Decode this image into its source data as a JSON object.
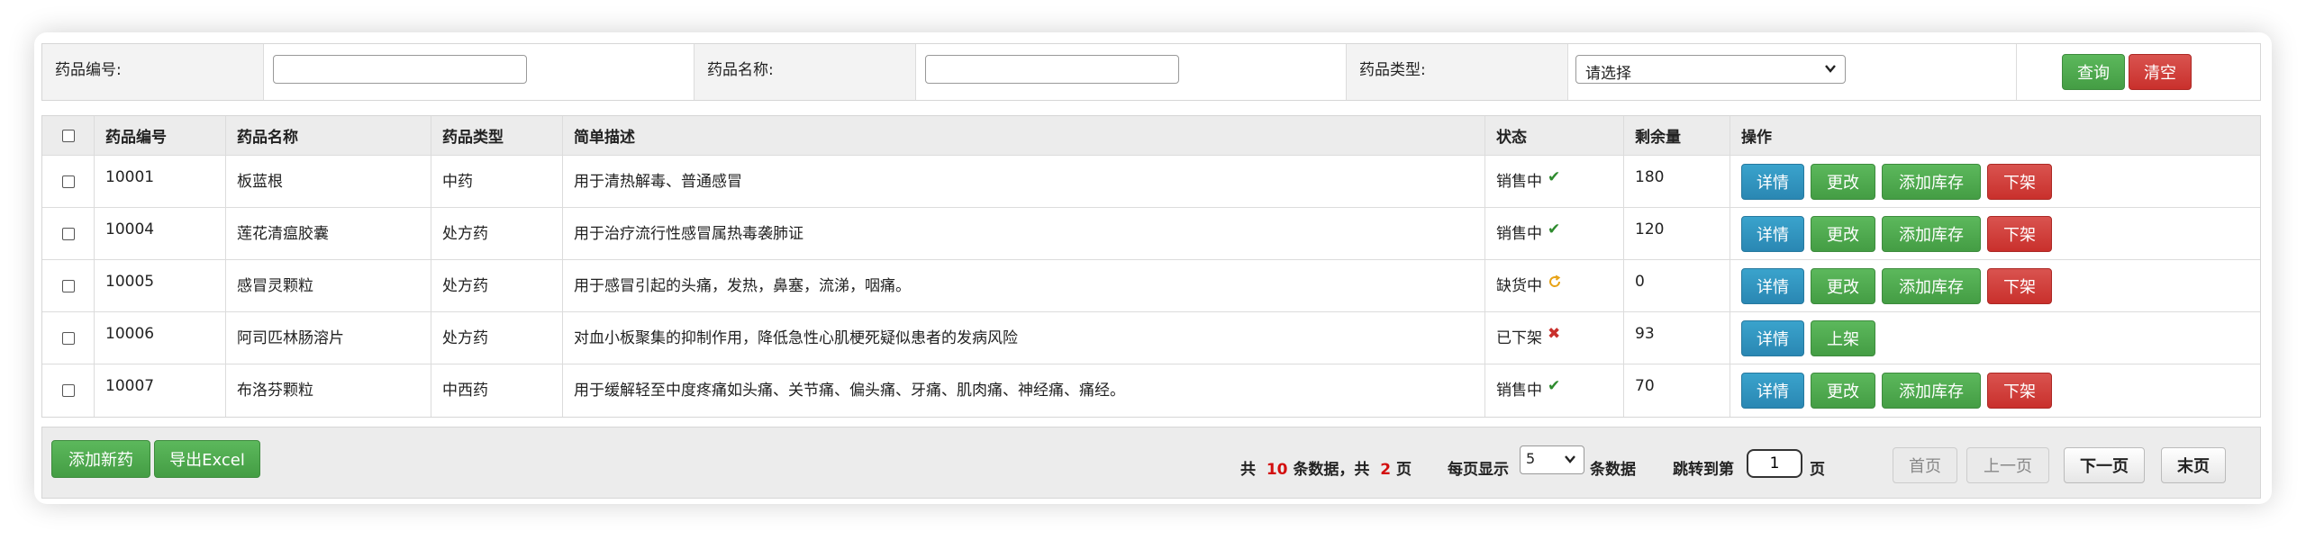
{
  "search": {
    "code_label": "药品编号:",
    "code_value": "",
    "name_label": "药品名称:",
    "name_value": "",
    "type_label": "药品类型:",
    "type_selected": "请选择",
    "query_button": "查询",
    "clear_button": "清空"
  },
  "table": {
    "headers": [
      "药品编号",
      "药品名称",
      "药品类型",
      "简单描述",
      "状态",
      "剩余量",
      "操作"
    ],
    "rows": [
      {
        "code": "10001",
        "name": "板蓝根",
        "type": "中药",
        "desc": "用于清热解毒、普通感冒",
        "status": "销售中",
        "status_icon": "check-icon",
        "stock": "180",
        "actions": [
          "详情",
          "更改",
          "添加库存",
          "下架"
        ]
      },
      {
        "code": "10004",
        "name": "莲花清瘟胶囊",
        "type": "处方药",
        "desc": "用于治疗流行性感冒属热毒袭肺证",
        "status": "销售中",
        "status_icon": "check-icon",
        "stock": "120",
        "actions": [
          "详情",
          "更改",
          "添加库存",
          "下架"
        ]
      },
      {
        "code": "10005",
        "name": "感冒灵颗粒",
        "type": "处方药",
        "desc": "用于感冒引起的头痛，发热，鼻塞，流涕，咽痛。",
        "status": "缺货中",
        "status_icon": "refresh-icon",
        "stock": "0",
        "actions": [
          "详情",
          "更改",
          "添加库存",
          "下架"
        ]
      },
      {
        "code": "10006",
        "name": "阿司匹林肠溶片",
        "type": "处方药",
        "desc": "对血小板聚集的抑制作用，降低急性心肌梗死疑似患者的发病风险",
        "status": "已下架",
        "status_icon": "cross-icon",
        "stock": "93",
        "actions": [
          "详情",
          "上架"
        ]
      },
      {
        "code": "10007",
        "name": "布洛芬颗粒",
        "type": "中西药",
        "desc": "用于缓解轻至中度疼痛如头痛、关节痛、偏头痛、牙痛、肌肉痛、神经痛、痛经。",
        "status": "销售中",
        "status_icon": "check-icon",
        "stock": "70",
        "actions": [
          "详情",
          "更改",
          "添加库存",
          "下架"
        ]
      }
    ]
  },
  "footer": {
    "add_button": "添加新药",
    "export_button": "导出Excel",
    "total_prefix": "共",
    "total_count": "10",
    "total_mid": "条数据，共",
    "total_pages": "2",
    "total_suffix": "页",
    "per_page_label": "每页显示",
    "per_page_value": "5",
    "per_page_suffix": "条数据",
    "jump_label": "跳转到第",
    "jump_value": "1",
    "jump_suffix": "页",
    "first": "首页",
    "prev": "上一页",
    "next": "下一页",
    "last": "末页"
  },
  "colors": {
    "primary_green": "#5cb85c",
    "danger_red": "#d9534f",
    "info_blue": "#3aa3cc",
    "highlight_red_text": "#d30f0f"
  }
}
